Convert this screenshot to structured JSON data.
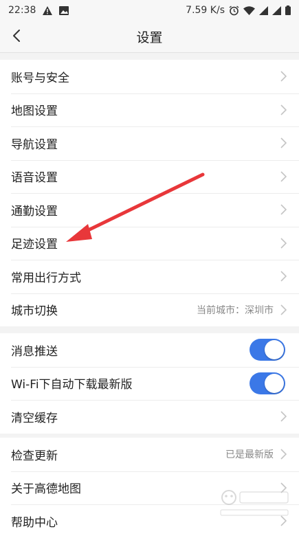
{
  "status_bar": {
    "time": "22:38",
    "network_speed": "7.59 K/s",
    "icons": [
      "warning-icon",
      "image-icon",
      "alarm-icon",
      "wifi-icon",
      "signal-icon",
      "signal-icon",
      "battery-icon"
    ]
  },
  "header": {
    "title": "设置",
    "back_icon": "chevron-left-icon"
  },
  "group1": [
    {
      "label": "账号与安全"
    },
    {
      "label": "地图设置"
    },
    {
      "label": "导航设置"
    },
    {
      "label": "语音设置"
    },
    {
      "label": "通勤设置"
    },
    {
      "label": "足迹设置"
    },
    {
      "label": "常用出行方式"
    },
    {
      "label": "城市切换",
      "value": "当前城市：深圳市"
    }
  ],
  "group2": [
    {
      "label": "消息推送",
      "toggle": true
    },
    {
      "label": "Wi-Fi下自动下载最新版",
      "toggle": true
    },
    {
      "label": "清空缓存"
    }
  ],
  "group3": [
    {
      "label": "检查更新",
      "value": "已是最新版"
    },
    {
      "label": "关于高德地图"
    },
    {
      "label": "帮助中心"
    }
  ],
  "colors": {
    "toggle_on": "#3b78e7",
    "annotation_arrow": "#e8373a"
  }
}
